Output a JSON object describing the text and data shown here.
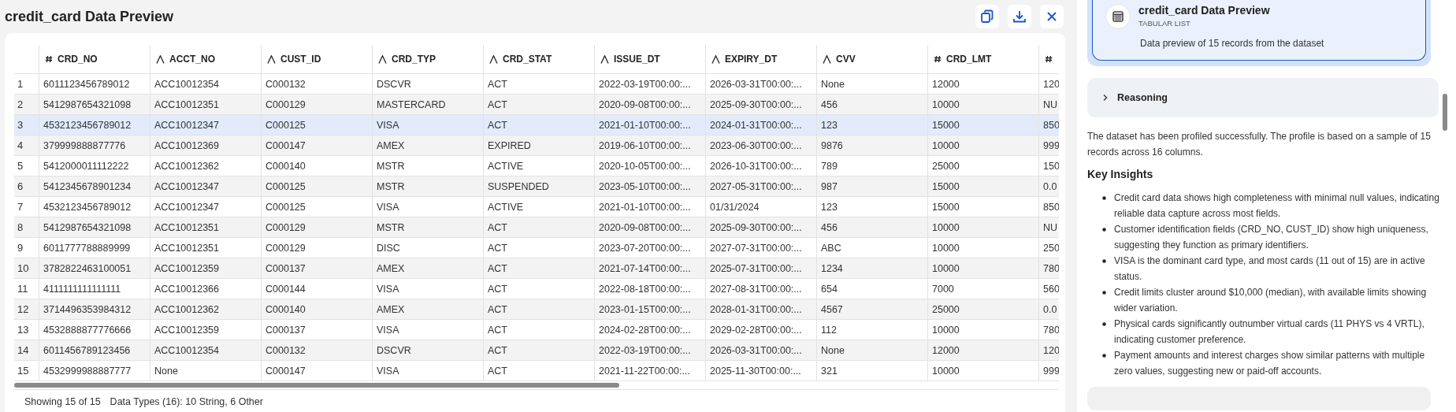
{
  "title": "credit_card Data Preview",
  "toolbar": [
    {
      "kind": "copy"
    },
    {
      "kind": "download"
    },
    {
      "kind": "close"
    }
  ],
  "table": {
    "columns": [
      {
        "name": "CRD_NO",
        "kind": "number"
      },
      {
        "name": "ACCT_NO",
        "kind": "text"
      },
      {
        "name": "CUST_ID",
        "kind": "text"
      },
      {
        "name": "CRD_TYP",
        "kind": "text"
      },
      {
        "name": "CRD_STAT",
        "kind": "text"
      },
      {
        "name": "ISSUE_DT",
        "kind": "text"
      },
      {
        "name": "EXPIRY_DT",
        "kind": "text"
      },
      {
        "name": "CVV",
        "kind": "text"
      },
      {
        "name": "CRD_LMT",
        "kind": "number"
      },
      {
        "kind": "number"
      }
    ],
    "rows": [
      {
        "number": "1",
        "selected": false,
        "cells": [
          "6011123456789012",
          "ACC10012354",
          "C000132",
          "DSCVR",
          "ACT",
          "2022-03-19T00:00:...",
          "2026-03-31T00:00:...",
          "None",
          "12000",
          "120"
        ]
      },
      {
        "number": "2",
        "selected": false,
        "cells": [
          "5412987654321098",
          "ACC10012351",
          "C000129",
          "MASTERCARD",
          "ACT",
          "2020-09-08T00:00:...",
          "2025-09-30T00:00:...",
          "456",
          "10000",
          "NU"
        ]
      },
      {
        "number": "3",
        "selected": true,
        "cells": [
          "4532123456789012",
          "ACC10012347",
          "C000125",
          "VISA",
          "ACT",
          "2021-01-10T00:00:...",
          "2024-01-31T00:00:...",
          "123",
          "15000",
          "850"
        ]
      },
      {
        "number": "4",
        "selected": false,
        "cells": [
          "379999888877776",
          "ACC10012369",
          "C000147",
          "AMEX",
          "EXPIRED",
          "2019-06-10T00:00:...",
          "2023-06-30T00:00:...",
          "9876",
          "10000",
          "999"
        ]
      },
      {
        "number": "5",
        "selected": false,
        "cells": [
          "5412000011112222",
          "ACC10012362",
          "C000140",
          "MSTR",
          "ACTIVE",
          "2020-10-05T00:00:...",
          "2026-10-31T00:00:...",
          "789",
          "25000",
          "150"
        ]
      },
      {
        "number": "6",
        "selected": false,
        "cells": [
          "5412345678901234",
          "ACC10012347",
          "C000125",
          "MSTR",
          "SUSPENDED",
          "2023-05-10T00:00:...",
          "2027-05-31T00:00:...",
          "987",
          "15000",
          "0.0"
        ]
      },
      {
        "number": "7",
        "selected": false,
        "cells": [
          "4532123456789012",
          "ACC10012347",
          "C000125",
          "VISA",
          "ACTIVE",
          "2021-01-10T00:00:...",
          "01/31/2024",
          "123",
          "15000",
          "850"
        ]
      },
      {
        "number": "8",
        "selected": false,
        "cells": [
          "5412987654321098",
          "ACC10012351",
          "C000129",
          "MSTR",
          "ACT",
          "2020-09-08T00:00:...",
          "2025-09-30T00:00:...",
          "456",
          "10000",
          "NU"
        ]
      },
      {
        "number": "9",
        "selected": false,
        "cells": [
          "6011777788889999",
          "ACC10012351",
          "C000129",
          "DISC",
          "ACT",
          "2023-07-20T00:00:...",
          "2027-07-31T00:00:...",
          "ABC",
          "10000",
          "250"
        ]
      },
      {
        "number": "10",
        "selected": false,
        "cells": [
          "3782822463100051",
          "ACC10012359",
          "C000137",
          "AMEX",
          "ACT",
          "2021-07-14T00:00:...",
          "2025-07-31T00:00:...",
          "1234",
          "10000",
          "780"
        ]
      },
      {
        "number": "11",
        "selected": false,
        "cells": [
          "4111111111111111",
          "ACC10012366",
          "C000144",
          "VISA",
          "ACT",
          "2022-08-18T00:00:...",
          "2027-08-31T00:00:...",
          "654",
          "7000",
          "560"
        ]
      },
      {
        "number": "12",
        "selected": false,
        "cells": [
          "3714496353984312",
          "ACC10012362",
          "C000140",
          "AMEX",
          "ACT",
          "2023-01-15T00:00:...",
          "2028-01-31T00:00:...",
          "4567",
          "25000",
          "0.0"
        ]
      },
      {
        "number": "13",
        "selected": false,
        "cells": [
          "4532888877776666",
          "ACC10012359",
          "C000137",
          "VISA",
          "ACT",
          "2024-02-28T00:00:...",
          "2029-02-28T00:00:...",
          "112",
          "10000",
          "780"
        ]
      },
      {
        "number": "14",
        "selected": false,
        "cells": [
          "6011456789123456",
          "ACC10012354",
          "C000132",
          "DSCVR",
          "ACT",
          "2022-03-19T00:00:...",
          "2026-03-31T00:00:...",
          "None",
          "12000",
          "120"
        ]
      },
      {
        "number": "15",
        "selected": false,
        "cells": [
          "4532999988887777",
          "None",
          "C000147",
          "VISA",
          "ACT",
          "2021-11-22T00:00:...",
          "2025-11-30T00:00:...",
          "321",
          "10000",
          "999"
        ]
      }
    ]
  },
  "footer": {
    "showing": "Showing 15 of 15",
    "data_types": "Data Types (16): 10 String, 6 Other"
  },
  "side_panel": {
    "artifact_card": {
      "title": "credit_card Data Preview",
      "subtitle": "TABULAR LIST",
      "description": "Data preview of 15 records from the dataset",
      "selected": true
    },
    "reasoning": {
      "label": "Reasoning",
      "expanded": false
    },
    "summary": "The dataset has been profiled successfully. The profile is based on a sample of 15 records across 16 columns.",
    "heading": "Key Insights",
    "insights": [
      "Credit card data shows high completeness with minimal null values, indicating reliable data capture across most fields.",
      "Customer identification fields (CRD_NO, CUST_ID) show high uniqueness, suggesting they function as primary identifiers.",
      "VISA is the dominant card type, and most cards (11 out of 15) are in active status.",
      "Credit limits cluster around $10,000 (median), with available limits showing wider variation.",
      "Physical cards significantly outnumber virtual cards (11 PHYS vs 4 VRTL), indicating customer preference.",
      "Payment amounts and interest charges show similar patterns with multiple zero values, suggesting new or paid-off accounts."
    ]
  }
}
